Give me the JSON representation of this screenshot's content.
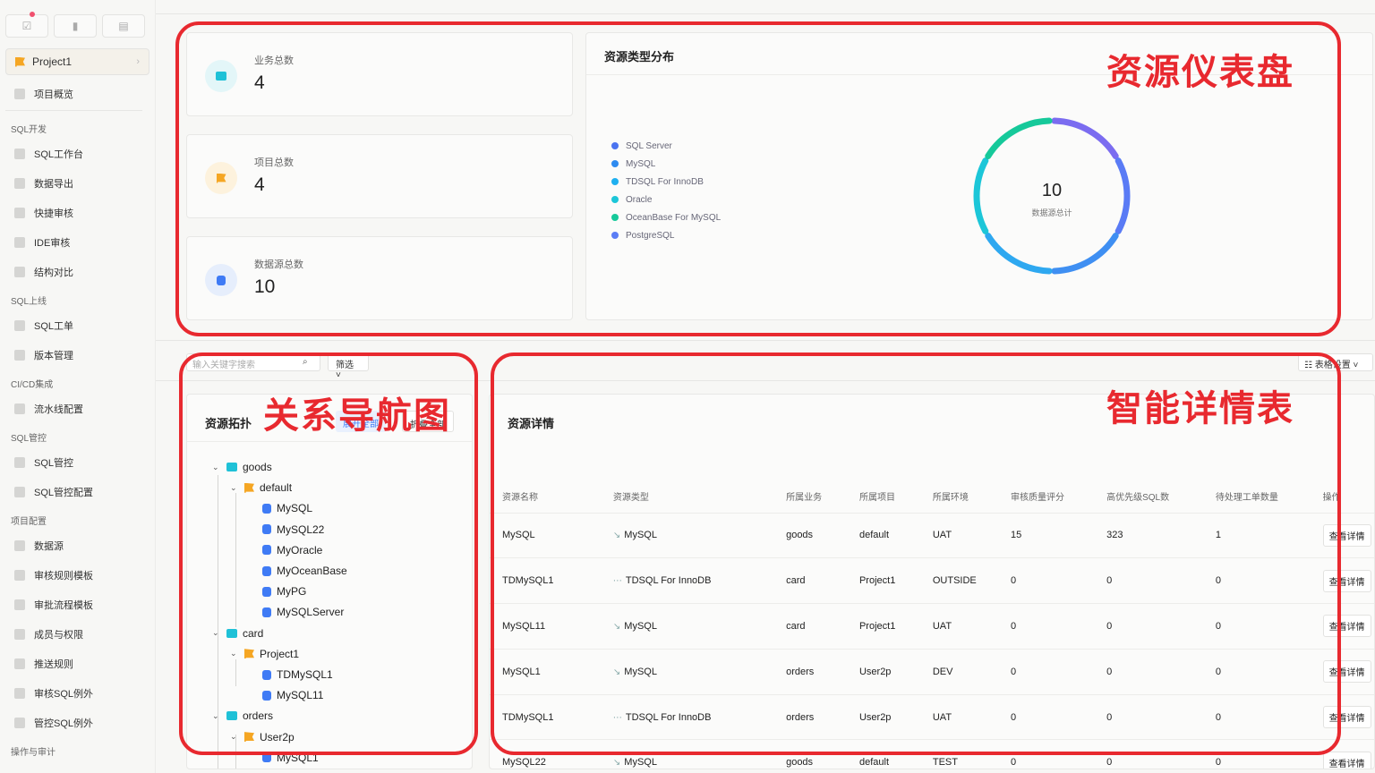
{
  "sidebar": {
    "project": "Project1",
    "overview": "项目概览",
    "sections": [
      {
        "title": "SQL开发",
        "items": [
          "SQL工作台",
          "数据导出",
          "快捷审核",
          "IDE审核",
          "结构对比"
        ]
      },
      {
        "title": "SQL上线",
        "items": [
          "SQL工单",
          "版本管理"
        ]
      },
      {
        "title": "CI/CD集成",
        "items": [
          "流水线配置"
        ]
      },
      {
        "title": "SQL管控",
        "items": [
          "SQL管控",
          "SQL管控配置"
        ]
      },
      {
        "title": "项目配置",
        "items": [
          "数据源",
          "审核规则模板",
          "审批流程模板",
          "成员与权限",
          "推送规则",
          "审核SQL例外",
          "管控SQL例外"
        ]
      },
      {
        "title": "操作与审计",
        "items": []
      }
    ]
  },
  "stats": [
    {
      "label": "业务总数",
      "value": "4"
    },
    {
      "label": "项目总数",
      "value": "4"
    },
    {
      "label": "数据源总数",
      "value": "10"
    }
  ],
  "distribution": {
    "title": "资源类型分布",
    "legend": [
      {
        "name": "SQL Server",
        "color": "#4b74f0"
      },
      {
        "name": "MySQL",
        "color": "#2e8bf0"
      },
      {
        "name": "TDSQL For InnoDB",
        "color": "#1fb0f0"
      },
      {
        "name": "Oracle",
        "color": "#1cc6d8"
      },
      {
        "name": "OceanBase For MySQL",
        "color": "#16c99a"
      },
      {
        "name": "PostgreSQL",
        "color": "#5b7df5"
      }
    ],
    "total": "10",
    "total_label": "数据源总计"
  },
  "annotations": {
    "dashboard": "资源仪表盘",
    "nav": "关系导航图",
    "table": "智能详情表"
  },
  "filter": {
    "search_placeholder": "输入关键字搜索",
    "filter_label": "筛选",
    "table_settings": "表格设置"
  },
  "topology": {
    "title": "资源拓扑",
    "expand_all": "展开全部",
    "refresh": "折叠全部",
    "nodes": [
      {
        "label": "goods",
        "kind": "biz"
      },
      {
        "label": "default",
        "kind": "project"
      },
      {
        "label": "MySQL",
        "kind": "db"
      },
      {
        "label": "MySQL22",
        "kind": "db"
      },
      {
        "label": "MyOracle",
        "kind": "db"
      },
      {
        "label": "MyOceanBase",
        "kind": "db"
      },
      {
        "label": "MyPG",
        "kind": "db"
      },
      {
        "label": "MySQLServer",
        "kind": "db"
      },
      {
        "label": "card",
        "kind": "biz"
      },
      {
        "label": "Project1",
        "kind": "project"
      },
      {
        "label": "TDMySQL1",
        "kind": "db"
      },
      {
        "label": "MySQL11",
        "kind": "db"
      },
      {
        "label": "orders",
        "kind": "biz"
      },
      {
        "label": "User2p",
        "kind": "project"
      },
      {
        "label": "MySQL1",
        "kind": "db"
      }
    ]
  },
  "details": {
    "title": "资源详情",
    "columns": [
      "资源名称",
      "资源类型",
      "所属业务",
      "所属项目",
      "所属环境",
      "审核质量评分",
      "高优先级SQL数",
      "待处理工单数量",
      "操作"
    ],
    "rows": [
      [
        "MySQL",
        "MySQL",
        "goods",
        "default",
        "UAT",
        "15",
        "323",
        "1",
        "查看详情"
      ],
      [
        "TDMySQL1",
        "TDSQL For InnoDB",
        "card",
        "Project1",
        "OUTSIDE",
        "0",
        "0",
        "0",
        "查看详情"
      ],
      [
        "MySQL11",
        "MySQL",
        "card",
        "Project1",
        "UAT",
        "0",
        "0",
        "0",
        "查看详情"
      ],
      [
        "MySQL1",
        "MySQL",
        "orders",
        "User2p",
        "DEV",
        "0",
        "0",
        "0",
        "查看详情"
      ],
      [
        "TDMySQL1",
        "TDSQL For InnoDB",
        "orders",
        "User2p",
        "UAT",
        "0",
        "0",
        "0",
        "查看详情"
      ],
      [
        "MySQL22",
        "MySQL",
        "goods",
        "default",
        "TEST",
        "0",
        "0",
        "0",
        "查看详情"
      ]
    ]
  }
}
